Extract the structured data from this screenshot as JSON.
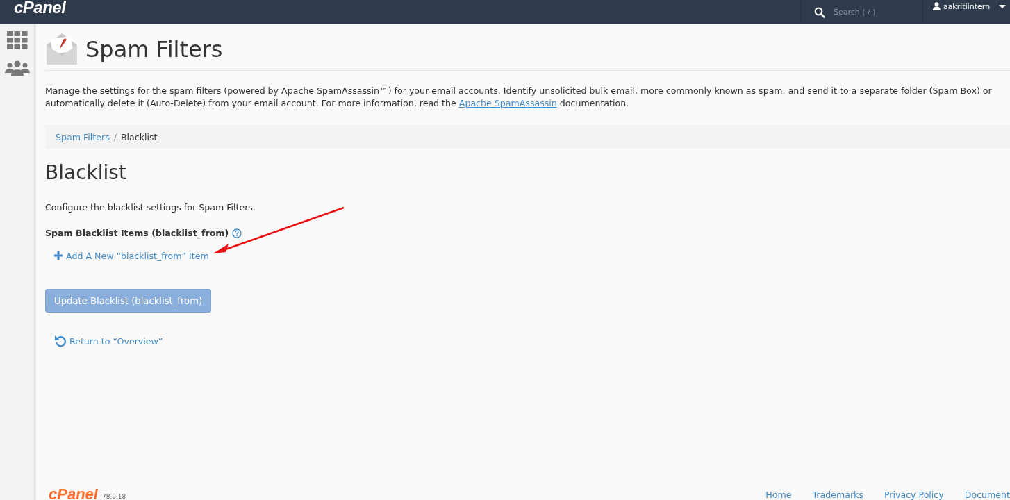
{
  "topbar": {
    "logo": "cPanel",
    "search": {
      "placeholder": "Search ( / )"
    },
    "user": "aakritiintern"
  },
  "page": {
    "title": "Spam Filters",
    "description": {
      "text": "Manage the settings for the spam filters (powered by Apache SpamAssassin™) for your email accounts. Identify unsolicited bulk email, more commonly known as spam, and send it to a separate folder (Spam Box) or automatically delete it (Auto-Delete) from your email account. For more information, read the",
      "link": "Apache SpamAssassin",
      "after": "documentation."
    }
  },
  "breadcrumb_separator": "/",
  "breadcrumb": [
    {
      "label": "Spam Filters",
      "link": true
    },
    {
      "label": "Blacklist",
      "link": false
    }
  ],
  "section": {
    "title": "Blacklist",
    "intro": "Configure the blacklist settings for Spam Filters.",
    "items_label": "Spam Blacklist Items (blacklist_from)",
    "add_link": "Add A New “blacklist_from” Item",
    "update_button": {
      "label": "Update Blacklist (blacklist_from)",
      "disabled": true
    },
    "return_link": "Return to “Overview”"
  },
  "footer": {
    "logo": "cPanel",
    "version": "78.0.18",
    "links": [
      "Home",
      "Trademarks",
      "Privacy Policy",
      "Document"
    ]
  }
}
